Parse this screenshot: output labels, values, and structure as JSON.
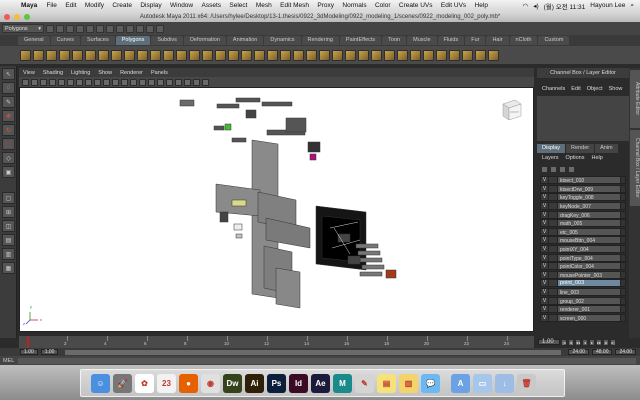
{
  "menubar": {
    "app": "Maya",
    "items": [
      "File",
      "Edit",
      "Modify",
      "Create",
      "Display",
      "Window",
      "Assets",
      "Select",
      "Mesh",
      "Edit Mesh",
      "Proxy",
      "Normals",
      "Color",
      "Create UVs",
      "Edit UVs",
      "Help"
    ],
    "clock": "(월) 오전 11:31",
    "user": "Hayoun Lee"
  },
  "window": {
    "title": "Autodesk Maya 2011 x64: /Users/hylee/Desktop/13-1.thesis/0922_3dModeling/0922_modeling_1/scenes/0922_modeling_002_poly.mb*"
  },
  "statusline": {
    "mode": "Polygons"
  },
  "shelf": {
    "tabs": [
      "General",
      "Curves",
      "Surfaces",
      "Polygons",
      "Subdivs",
      "Deformation",
      "Animation",
      "Dynamics",
      "Rendering",
      "PaintEffects",
      "Toon",
      "Muscle",
      "Fluids",
      "Fur",
      "Hair",
      "nCloth",
      "Custom"
    ],
    "active_tab": "Polygons"
  },
  "viewport": {
    "menu": [
      "View",
      "Shading",
      "Lighting",
      "Show",
      "Renderer",
      "Panels"
    ],
    "viewcube_label": "FRONT",
    "axis_labels": [
      "y",
      "x",
      "z"
    ]
  },
  "channelbox": {
    "title": "Channel Box / Layer Editor",
    "menu": [
      "Channels",
      "Edit",
      "Object",
      "Show"
    ]
  },
  "side_tabs": [
    "Attribute Editor",
    "Channel Box / Layer Editor"
  ],
  "layer_editor": {
    "tabs": [
      "Display",
      "Render",
      "Anim"
    ],
    "active_tab": "Display",
    "menu": [
      "Layers",
      "Options",
      "Help"
    ],
    "layers": [
      {
        "v": "V",
        "name": "ktsect_010"
      },
      {
        "v": "V",
        "name": "ktsectDrw_009"
      },
      {
        "v": "V",
        "name": "keyToggle_008"
      },
      {
        "v": "V",
        "name": "keyNode_007"
      },
      {
        "v": "V",
        "name": "dragKey_006"
      },
      {
        "v": "V",
        "name": "math_005"
      },
      {
        "v": "V",
        "name": "etc_005"
      },
      {
        "v": "V",
        "name": "mouseBttn_004"
      },
      {
        "v": "V",
        "name": "pointXY_004"
      },
      {
        "v": "V",
        "name": "pointType_004"
      },
      {
        "v": "V",
        "name": "pointColor_004"
      },
      {
        "v": "V",
        "name": "mousePointer_003"
      },
      {
        "v": "V",
        "name": "point_003",
        "selected": true
      },
      {
        "v": "V",
        "name": "line_003"
      },
      {
        "v": "V",
        "name": "group_002"
      },
      {
        "v": "V",
        "name": "renderer_001"
      },
      {
        "v": "V",
        "name": "screen_000"
      }
    ]
  },
  "timeslider": {
    "ticks": [
      "2",
      "4",
      "6",
      "8",
      "10",
      "12",
      "14",
      "16",
      "18",
      "20",
      "22",
      "24"
    ],
    "current_frame": "1.00",
    "start": "1.00",
    "end": "24.00",
    "range_start": "1.00",
    "range_end": "24.00",
    "anim_end": "48.00"
  },
  "cmdline": {
    "label": "MEL"
  },
  "dock": {
    "apps": [
      {
        "name": "Finder",
        "glyph": "☺",
        "color": "#4a8fe0"
      },
      {
        "name": "Launchpad",
        "glyph": "🚀",
        "color": "#777777"
      },
      {
        "name": "Photos",
        "glyph": "✿",
        "color": "#ffffff"
      },
      {
        "name": "Calendar",
        "glyph": "23",
        "color": "#f2f2f2"
      },
      {
        "name": "Firefox",
        "glyph": "●",
        "color": "#e66000"
      },
      {
        "name": "Chrome",
        "glyph": "◉",
        "color": "#e0e0e0"
      },
      {
        "name": "Dreamweaver",
        "glyph": "Dw",
        "color": "#35431c"
      },
      {
        "name": "Illustrator",
        "glyph": "Ai",
        "color": "#2e1f06"
      },
      {
        "name": "Photoshop",
        "glyph": "Ps",
        "color": "#0b1f3b"
      },
      {
        "name": "InDesign",
        "glyph": "Id",
        "color": "#3b0b25"
      },
      {
        "name": "After Effects",
        "glyph": "Ae",
        "color": "#1c1a3a"
      },
      {
        "name": "Maya",
        "glyph": "M",
        "color": "#1b8a8a"
      },
      {
        "name": "Script Editor",
        "glyph": "✎",
        "color": "#d4d4d4"
      },
      {
        "name": "Stickies",
        "glyph": "▤",
        "color": "#f5e27a"
      },
      {
        "name": "Notes",
        "glyph": "▥",
        "color": "#f3d36b"
      },
      {
        "name": "Messages",
        "glyph": "💬",
        "color": "#6bb8f2"
      },
      {
        "name": "Applications",
        "glyph": "A",
        "color": "#6aa2e4"
      },
      {
        "name": "Documents",
        "glyph": "▭",
        "color": "#a6c6ea"
      },
      {
        "name": "Downloads",
        "glyph": "↓",
        "color": "#9dbde4"
      },
      {
        "name": "Trash",
        "glyph": "🗑",
        "color": "#c9c9c9"
      }
    ]
  }
}
